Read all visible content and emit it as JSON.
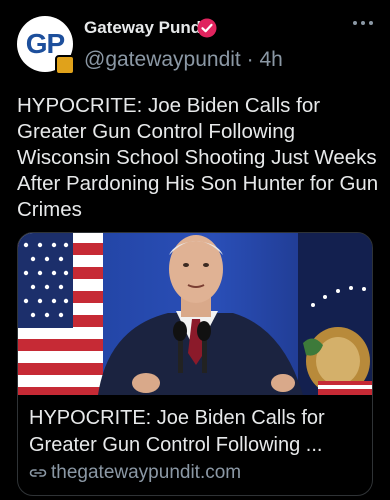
{
  "post": {
    "author_name": "Gateway Pundit",
    "avatar_text": "GP",
    "handle": "@gatewaypundit",
    "separator": "·",
    "time": "4h",
    "text": "HYPOCRITE: Joe Biden Calls for Greater Gun Control Following Wisconsin School Shooting Just Weeks After Pardoning His Son Hunter for Gun Crimes"
  },
  "card": {
    "title": "HYPOCRITE: Joe Biden Calls for Greater Gun Control Following ...",
    "domain": "thegatewaypundit.com"
  },
  "icons": {
    "verified": "verified-badge-icon",
    "more": "more-options-icon",
    "link": "link-icon"
  },
  "colors": {
    "background": "#000000",
    "text": "#e7e9ea",
    "muted": "#8b98a5",
    "verified": "#e0245e",
    "border": "#2f3336"
  }
}
